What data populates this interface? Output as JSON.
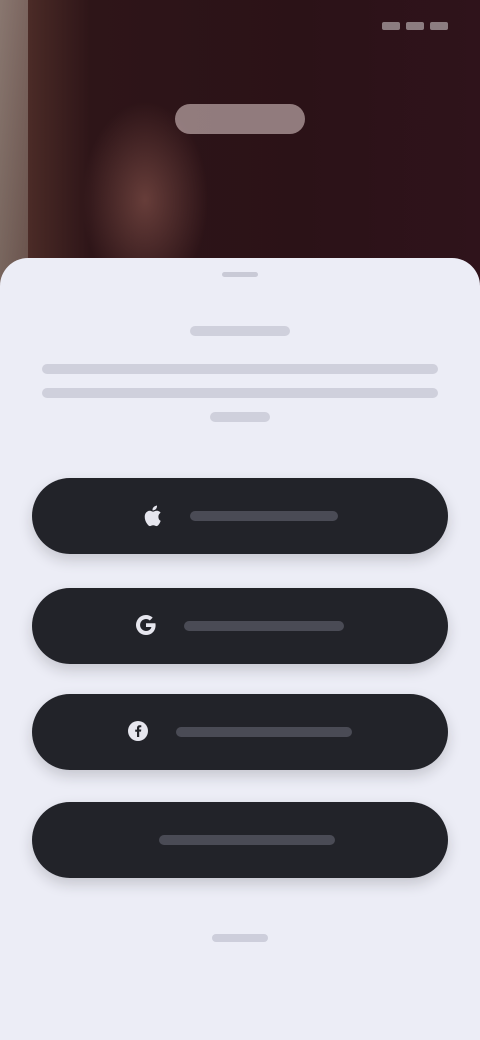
{
  "hero": {
    "status_time": "",
    "logo_icon": "brand-logo"
  },
  "sheet": {
    "title": "",
    "description": ""
  },
  "auth_buttons": [
    {
      "icon": "apple-icon",
      "label": ""
    },
    {
      "icon": "google-icon",
      "label": ""
    },
    {
      "icon": "facebook-icon",
      "label": ""
    },
    {
      "icon": "email-icon",
      "label": ""
    }
  ],
  "footer": {
    "link_label": ""
  },
  "colors": {
    "hero_bg": "#2b1217",
    "sheet_bg": "#ecedf6",
    "button_bg": "#222329"
  }
}
